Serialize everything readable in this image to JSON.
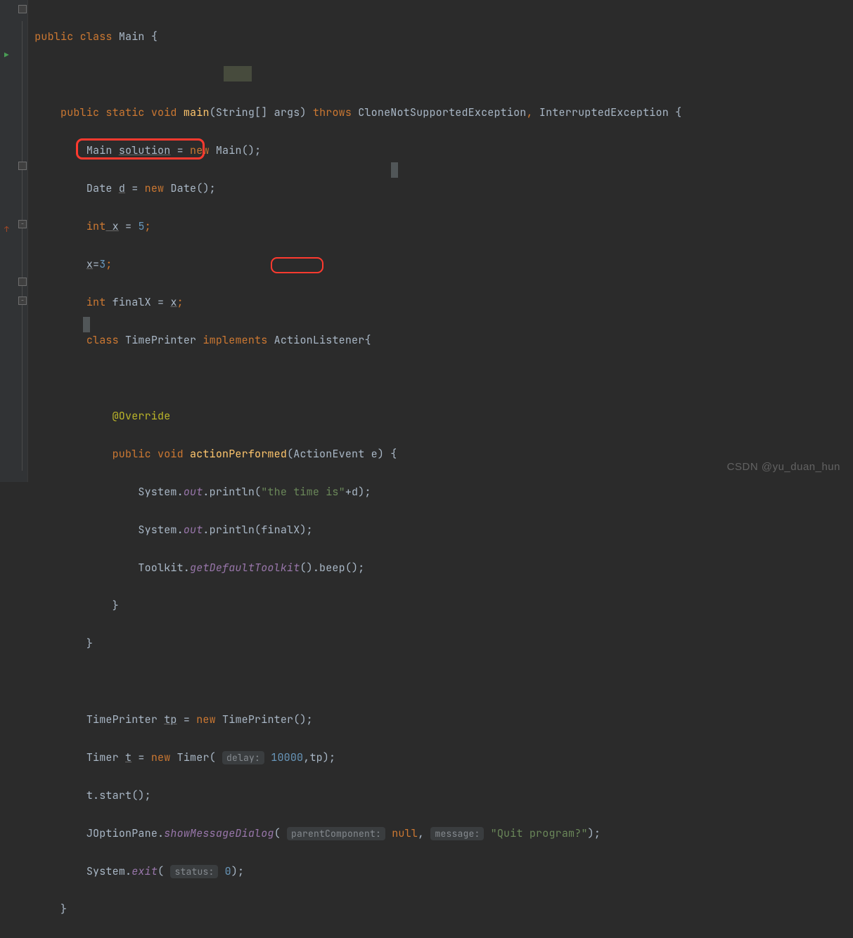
{
  "code": {
    "line1_public": "public",
    "line1_class": "class",
    "line1_Main": "Main",
    "line1_brace": " {",
    "line3_public": "public",
    "line3_static": "static",
    "line3_void": "void",
    "line3_main": "main",
    "line3_params": "(String[] args)",
    "line3_throws": "throws",
    "line3_ex1": "CloneNotSupportedException",
    "line3_comma": ",",
    "line3_ex2": "InterruptedException",
    "line3_brace": " {",
    "line4_Main": "Main ",
    "line4_sol": "solution",
    "line4_eq": " = ",
    "line4_new": "new",
    "line4_M2": " Main",
    "line4_rest": "();",
    "line5_Date": "Date ",
    "line5_d": "d",
    "line5_eq": " = ",
    "line5_new": "new",
    "line5_rest": " Date();",
    "line6_int": "int",
    "line6_x": " x",
    "line6_eq": " = ",
    "line6_5": "5",
    "line6_semi": ";",
    "line7_x": "x",
    "line7_eq": "=",
    "line7_3": "3",
    "line7_semi": ";",
    "line8_int": "int",
    "line8_finalX": " finalX = ",
    "line8_x": "x",
    "line8_semi": ";",
    "line9_class": "class",
    "line9_TP": " TimePrinter ",
    "line9_impl": "implements",
    "line9_AL": " ActionListener",
    "line9_brace": "{",
    "line11_ann": "@Override",
    "line12_public": "public",
    "line12_void": "void",
    "line12_mth": "actionPerformed",
    "line12_params": "(ActionEvent e) {",
    "line13a": "System.",
    "line13b": "out",
    "line13c": ".println(",
    "line13d": "\"the time is\"",
    "line13e": "+d);",
    "line14a": "System.",
    "line14b": "out",
    "line14c": ".println(",
    "line14d": "finalX",
    "line14e": ");",
    "line15a": "Toolkit.",
    "line15b": "getDefaultToolkit",
    "line15c": "().beep();",
    "line16": "}",
    "line17": "}",
    "line19a": "TimePrinter ",
    "line19b": "tp",
    "line19c": " = ",
    "line19d": "new",
    "line19e": " TimePrinter();",
    "line20a": "Timer ",
    "line20b": "t",
    "line20c": " = ",
    "line20d": "new",
    "line20e": " Timer( ",
    "line20hint": "delay:",
    "line20f": " 10000",
    "line20g": ",tp);",
    "line21": "t.start();",
    "line22a": "JOptionPane.",
    "line22b": "showMessageDialog",
    "line22c": "( ",
    "line22h1": "parentComponent:",
    "line22d": " null",
    "line22comma": ", ",
    "line22h2": "message:",
    "line22e": " \"Quit program?\"",
    "line22f": ");",
    "line23a": "System.",
    "line23b": "exit",
    "line23c": "( ",
    "line23h": "status:",
    "line23d": " 0",
    "line23e": ");",
    "line24": "}"
  },
  "watermark": "CSDN @yu_duan_hun"
}
